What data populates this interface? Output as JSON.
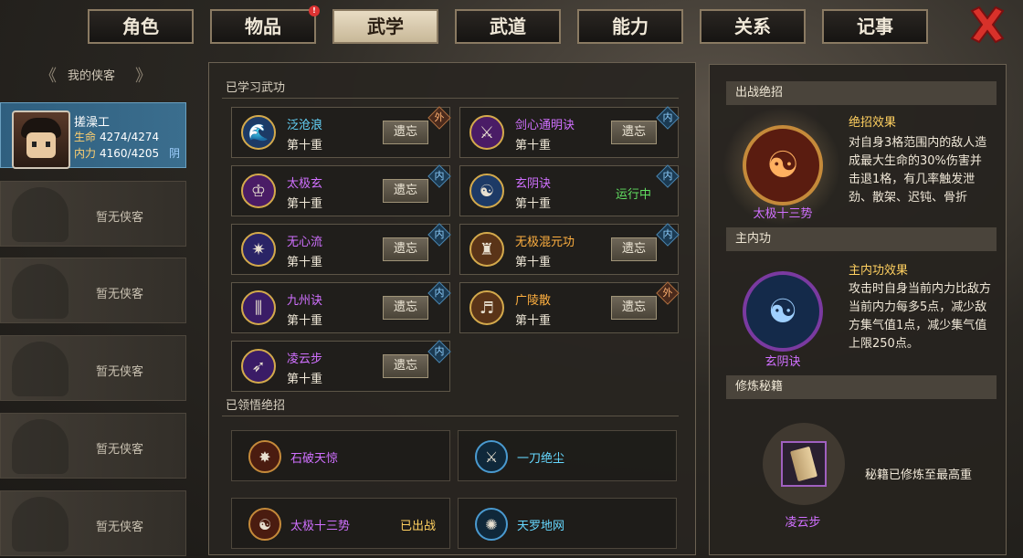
{
  "tabs": [
    {
      "label": "角色"
    },
    {
      "label": "物品"
    },
    {
      "label": "武学"
    },
    {
      "label": "武道"
    },
    {
      "label": "能力"
    },
    {
      "label": "关系"
    },
    {
      "label": "记事"
    }
  ],
  "tabs_active": "武学",
  "sidebar": {
    "title": "我的侠客",
    "active_char": {
      "name": "搓澡工",
      "hp_label": "生命",
      "hp": "4274/4274",
      "mp_label": "内力",
      "mp": "4160/4205",
      "tag": "阴"
    },
    "empty_label": "暂无侠客"
  },
  "learned": {
    "title": "已学习武功",
    "skills": [
      {
        "name": "泛沧浪",
        "level": "第十重",
        "action": "遗忘",
        "type": "外",
        "color": "#66d8ff"
      },
      {
        "name": "剑心通明诀",
        "level": "第十重",
        "action": "遗忘",
        "type": "内",
        "color": "#d070ff"
      },
      {
        "name": "太极玄",
        "level": "第十重",
        "action": "遗忘",
        "type": "内",
        "color": "#d070ff"
      },
      {
        "name": "玄阴诀",
        "level": "第十重",
        "action": "运行中",
        "type": "内",
        "color": "#d070ff"
      },
      {
        "name": "无心流",
        "level": "第十重",
        "action": "遗忘",
        "type": "内",
        "color": "#d070ff"
      },
      {
        "name": "无极混元功",
        "level": "第十重",
        "action": "遗忘",
        "type": "内",
        "color": "#ffb040"
      },
      {
        "name": "九州诀",
        "level": "第十重",
        "action": "遗忘",
        "type": "内",
        "color": "#d070ff"
      },
      {
        "name": "广陵散",
        "level": "第十重",
        "action": "遗忘",
        "type": "外",
        "color": "#ffb040"
      },
      {
        "name": "凌云步",
        "level": "第十重",
        "action": "遗忘",
        "type": "内",
        "color": "#d070ff"
      }
    ]
  },
  "ultimates": {
    "title": "已领悟绝招",
    "items": [
      {
        "name": "石破天惊",
        "color": "#d070ff",
        "status": ""
      },
      {
        "name": "一刀绝尘",
        "color": "#66d8ff",
        "status": ""
      },
      {
        "name": "太极十三势",
        "color": "#d070ff",
        "status": "已出战"
      },
      {
        "name": "天罗地网",
        "color": "#66d8ff",
        "status": ""
      }
    ]
  },
  "right": {
    "battle_title": "出战绝招",
    "battle_skill": "太极十三势",
    "battle_effect_title": "绝招效果",
    "battle_effect": "对自身3格范围内的敌人造成最大生命的30%伤害并击退1格，有几率触发泄劲、散架、迟钝、骨折",
    "inner_title": "主内功",
    "inner_skill": "玄阴诀",
    "inner_effect_title": "主内功效果",
    "inner_effect": "攻击时自身当前内力比敌方当前内力每多5点，减少敌方集气值1点，减少集气值上限250点。",
    "book_title": "修炼秘籍",
    "book_name": "凌云步",
    "book_msg": "秘籍已修炼至最高重"
  },
  "colors": {
    "purple": "#d070ff",
    "cyan": "#66d8ff",
    "gold": "#ffd060",
    "running": "#62e062"
  }
}
